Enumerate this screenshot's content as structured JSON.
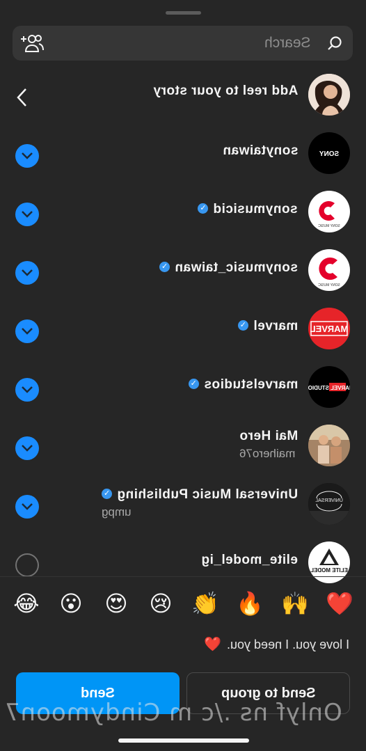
{
  "search": {
    "placeholder": "Search"
  },
  "story": {
    "label": "Add reel to your story"
  },
  "contacts": [
    {
      "name": "sonytaiwan",
      "verified": false,
      "sub": "",
      "selected": true,
      "avatar_text": "SONY",
      "avatar_color": "#000000"
    },
    {
      "name": "sonymusicid",
      "verified": true,
      "sub": "",
      "selected": true,
      "avatar_text": "SONY MUSIC",
      "avatar_color": "#ffffff"
    },
    {
      "name": "sonymusic_taiwan",
      "verified": true,
      "sub": "",
      "selected": true,
      "avatar_text": "SONY MUSIC",
      "avatar_color": "#ffffff"
    },
    {
      "name": "marvel",
      "verified": true,
      "sub": "",
      "selected": true,
      "avatar_text": "MARVEL",
      "avatar_color": "#e62429"
    },
    {
      "name": "marvelstudios",
      "verified": true,
      "sub": "",
      "selected": true,
      "avatar_text": "MARVEL STUDIOS",
      "avatar_color": "#000000"
    },
    {
      "name": "Mai Hero",
      "verified": false,
      "sub": "maihero76",
      "selected": true,
      "avatar_text": "",
      "avatar_color": "#8a6a4a"
    },
    {
      "name": "Universal Music Publishing",
      "verified": true,
      "sub": "umpg",
      "selected": true,
      "avatar_text": "UNIVERSAL",
      "avatar_color": "#111111"
    },
    {
      "name": "elite_model_ig",
      "verified": false,
      "sub": "",
      "selected": false,
      "avatar_text": "ELITE MODEL",
      "avatar_color": "#ffffff"
    }
  ],
  "reactions": [
    "😂",
    "😮",
    "😍",
    "😢",
    "👏",
    "🔥",
    "🙌",
    "❤️"
  ],
  "message": {
    "text": "I love you. I need you.",
    "emoji": "❤️"
  },
  "buttons": {
    "send": "Send",
    "send_to_group": "Send to group"
  },
  "watermark": "Onlyf ns ./c m Cindymoon7",
  "colors": {
    "accent": "#0095f6",
    "background": "#262626",
    "verified": "#3897f0"
  }
}
